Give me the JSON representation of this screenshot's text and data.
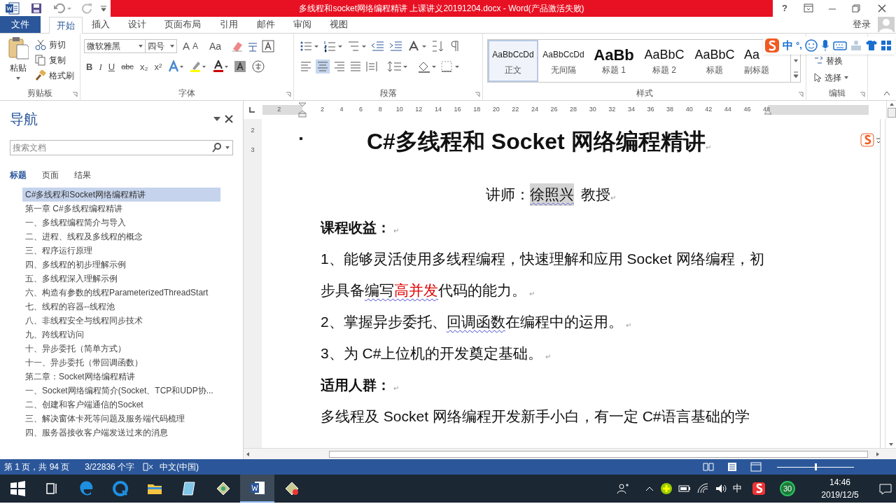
{
  "title_bar": {
    "title": "多线程和socket网络编程精讲 上课讲义20191204.docx -  Word(产品激活失败)",
    "help": "?"
  },
  "ribbon_tabs": [
    {
      "label": "文件",
      "kind": "file",
      "selected": false
    },
    {
      "label": "开始",
      "kind": "tab",
      "selected": true
    },
    {
      "label": "插入",
      "kind": "tab",
      "selected": false
    },
    {
      "label": "设计",
      "kind": "tab",
      "selected": false
    },
    {
      "label": "页面布局",
      "kind": "tab",
      "selected": false
    },
    {
      "label": "引用",
      "kind": "tab",
      "selected": false
    },
    {
      "label": "邮件",
      "kind": "tab",
      "selected": false
    },
    {
      "label": "审阅",
      "kind": "tab",
      "selected": false
    },
    {
      "label": "视图",
      "kind": "tab",
      "selected": false
    }
  ],
  "account": {
    "sign_in": "登录"
  },
  "clipboard": {
    "paste": "粘贴",
    "cut": "剪切",
    "copy": "复制",
    "format_painter": "格式刷",
    "group": "剪贴板"
  },
  "font": {
    "name": "微软雅黑",
    "size": "四号",
    "grow": "A",
    "shrink": "A",
    "change_case": "Aa",
    "format_buttons": [
      "B",
      "I",
      "U",
      "abc",
      "x₂",
      "x²"
    ],
    "group": "字体"
  },
  "paragraph": {
    "group": "段落"
  },
  "styles": {
    "group": "样式",
    "items": [
      {
        "preview": "AaBbCcDd",
        "name": "正文",
        "kind": "normal",
        "selected": true
      },
      {
        "preview": "AaBbCcDd",
        "name": "无间隔",
        "kind": "normal",
        "selected": false
      },
      {
        "preview": "AaBb",
        "name": "标题 1",
        "kind": "heading1",
        "selected": false
      },
      {
        "preview": "AaBbC",
        "name": "标题 2",
        "kind": "heading2",
        "selected": false
      },
      {
        "preview": "AaBbC",
        "name": "标题",
        "kind": "title",
        "selected": false
      },
      {
        "preview": "Aa",
        "name": "副标题",
        "kind": "subtitle",
        "selected": false
      }
    ]
  },
  "editing": {
    "replace": "替换",
    "select": "选择",
    "group": "编辑"
  },
  "ime_toolbar": {
    "mode": "中",
    "punctuation": "°,"
  },
  "navigation": {
    "title": "导航",
    "search": {
      "placeholder": "搜索文档"
    },
    "tabs": [
      {
        "label": "标题",
        "selected": true
      },
      {
        "label": "页面",
        "selected": false
      },
      {
        "label": "结果",
        "selected": false
      }
    ],
    "headings": [
      {
        "text": "C#多线程和Socket网络编程精讲",
        "selected": true
      },
      {
        "text": "第一章 C#多线程编程精讲",
        "selected": false
      },
      {
        "text": "一、多线程编程简介与导入",
        "selected": false
      },
      {
        "text": "二、进程、线程及多线程的概念",
        "selected": false
      },
      {
        "text": "三、程序运行原理",
        "selected": false
      },
      {
        "text": "四、多线程的初步理解示例",
        "selected": false
      },
      {
        "text": "五、多线程深入理解示例",
        "selected": false
      },
      {
        "text": "六、构造有参数的线程ParameterizedThreadStart",
        "selected": false
      },
      {
        "text": "七、线程的容器--线程池",
        "selected": false
      },
      {
        "text": "八、非线程安全与线程同步技术",
        "selected": false
      },
      {
        "text": "九、跨线程访问",
        "selected": false
      },
      {
        "text": "十、异步委托（简单方式）",
        "selected": false
      },
      {
        "text": "十一、异步委托（带回调函数）",
        "selected": false
      },
      {
        "text": "第二章：Socket网络编程精讲",
        "selected": false
      },
      {
        "text": "一、Socket网络编程简介(Socket、TCP和UDP协...",
        "selected": false
      },
      {
        "text": "二、创建和客户端通信的Socket",
        "selected": false
      },
      {
        "text": "三、解决窗体卡死等问题及服务端代码梳理",
        "selected": false
      },
      {
        "text": "四、服务器接收客户端发送过来的消息",
        "selected": false
      }
    ]
  },
  "ruler": {
    "numbers": [
      "2",
      "2",
      "4",
      "6",
      "8",
      "10",
      "12",
      "14",
      "16",
      "18",
      "20",
      "22",
      "24",
      "26",
      "28",
      "30",
      "32",
      "34",
      "36",
      "38",
      "40",
      "42",
      "44",
      "46",
      "48"
    ],
    "vertical_numbers": [
      "2",
      "3"
    ]
  },
  "document": {
    "title": "C#多线程和 Socket 网络编程精讲",
    "mark": "↵",
    "lecturer": {
      "label": "讲师：",
      "name": "徐照兴",
      "name_highlighted": true,
      "rank": "教授"
    },
    "blocks": [
      {
        "kind": "heading",
        "segments": [
          {
            "text": "课程收益：",
            "wavy": false,
            "red": false
          }
        ],
        "mark": true
      },
      {
        "kind": "line",
        "segments": [
          {
            "text": "1、能够灵活使用多线程编程，快速理解和应用 Socket 网络编程，初",
            "wavy": false,
            "red": false
          }
        ],
        "mark": false
      },
      {
        "kind": "line",
        "segments": [
          {
            "text": "步具备",
            "wavy": false,
            "red": false
          },
          {
            "text": "编写",
            "wavy": true,
            "red": false
          },
          {
            "text": "高并发",
            "wavy": true,
            "red": true
          },
          {
            "text": "代码的能力。",
            "wavy": false,
            "red": false
          }
        ],
        "mark": true
      },
      {
        "kind": "line",
        "segments": [
          {
            "text": "2、掌握异步委托、",
            "wavy": false,
            "red": false
          },
          {
            "text": "回调函数",
            "wavy": true,
            "red": false
          },
          {
            "text": "在编程中的运用。",
            "wavy": false,
            "red": false
          }
        ],
        "mark": true
      },
      {
        "kind": "line",
        "segments": [
          {
            "text": "3、为 C#上位机的开发奠定基础。",
            "wavy": false,
            "red": false
          }
        ],
        "mark": true
      },
      {
        "kind": "heading",
        "segments": [
          {
            "text": "适用人群：",
            "wavy": false,
            "red": false
          }
        ],
        "mark": true
      },
      {
        "kind": "line",
        "segments": [
          {
            "text": "多线程及 Socket 网络编程开发新手小白，有一定 C#语言基础的学",
            "wavy": false,
            "red": false
          }
        ],
        "mark": false
      }
    ]
  },
  "status_bar": {
    "page": "第 1 页，共 94 页",
    "words": "3/22836 个字",
    "language": "中文(中国)",
    "zoom_slider": {
      "level": 0.5
    }
  },
  "taskbar": {
    "ime": "中",
    "badge": "30",
    "time": "14:46",
    "date": "2019/12/5"
  }
}
